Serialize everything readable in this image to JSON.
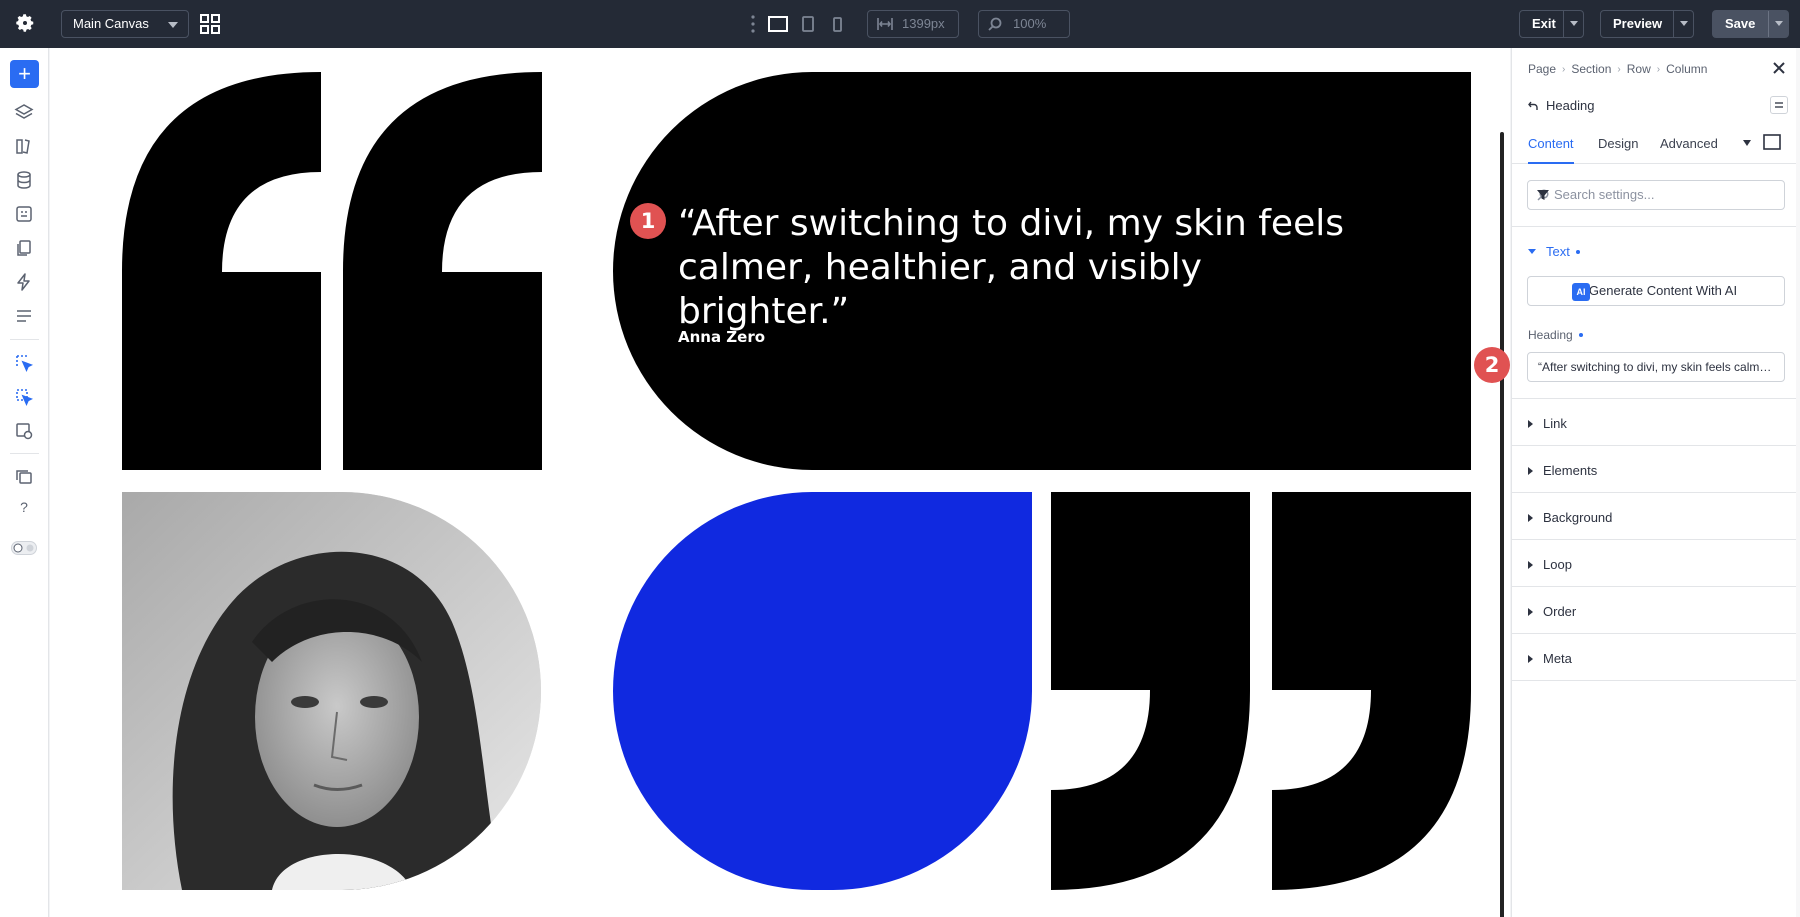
{
  "topbar": {
    "canvas_select": "Main Canvas",
    "width_field": "1399px",
    "zoom_field": "100%",
    "exit_label": "Exit",
    "preview_label": "Preview",
    "save_label": "Save",
    "save_bg": "#4a5262"
  },
  "leftbar": {
    "add_label": "+",
    "help_label": "?",
    "accent": "#2a6cf2",
    "icons": [
      "layers-icon",
      "library-icon",
      "database-icon",
      "portability-icon",
      "pages-icon",
      "lightning-icon",
      "settings-list-icon",
      "select-icon",
      "multi-select-icon",
      "theme-builder-icon",
      "copy-icon",
      "help-icon",
      "mode-toggle"
    ]
  },
  "canvas": {
    "heading": "“After switching to divi, my skin feels calmer, healthier, and visibly brighter.”",
    "author": "Anna Zero",
    "blue_color": "#1029e0",
    "marker1": "1",
    "marker2": "2"
  },
  "panel": {
    "breadcrumb": [
      "Page",
      "Section",
      "Row",
      "Column"
    ],
    "element": "Heading",
    "tabs": [
      "Content",
      "Design",
      "Advanced"
    ],
    "search_placeholder": "Search settings...",
    "text_section": "Text",
    "ai_badge": "AI",
    "ai_button": "Generate Content With AI",
    "heading_label": "Heading",
    "heading_value": "“After switching to divi, my skin feels calmer, healthier, and visibly brighter.”",
    "sections": [
      "Link",
      "Elements",
      "Background",
      "Loop",
      "Order",
      "Meta"
    ]
  }
}
